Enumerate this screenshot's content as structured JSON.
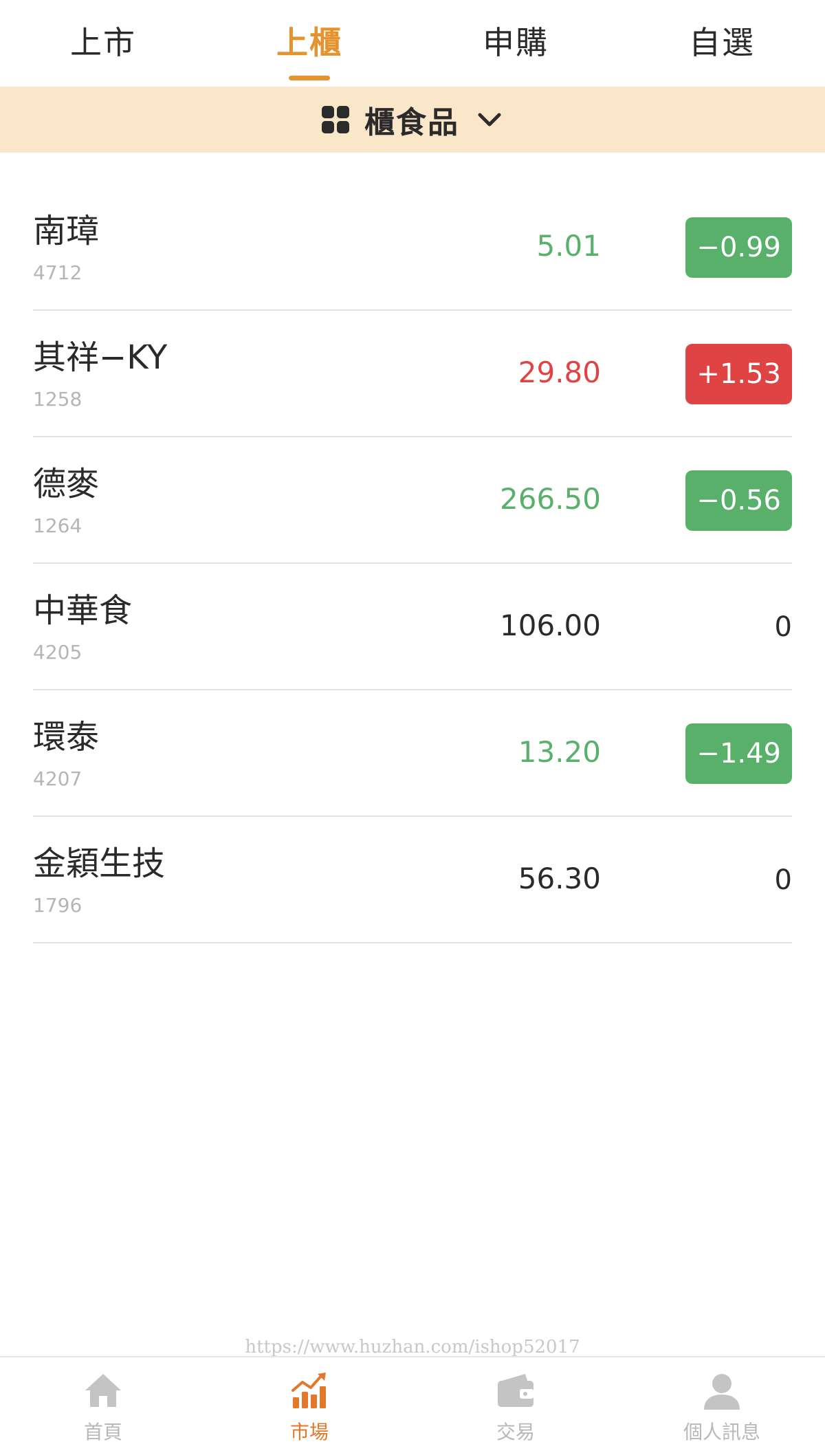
{
  "tabs": [
    {
      "label": "上市",
      "active": false
    },
    {
      "label": "上櫃",
      "active": true
    },
    {
      "label": "申購",
      "active": false
    },
    {
      "label": "自選",
      "active": false
    }
  ],
  "category": {
    "label": "櫃食品",
    "icon": "grid-icon",
    "dropdown_icon": "chevron-down-icon"
  },
  "stocks": [
    {
      "name": "南璋",
      "code": "4712",
      "price": "5.01",
      "change": "−0.99",
      "direction": "down"
    },
    {
      "name": "其祥−KY",
      "code": "1258",
      "price": "29.80",
      "change": "+1.53",
      "direction": "up"
    },
    {
      "name": "德麥",
      "code": "1264",
      "price": "266.50",
      "change": "−0.56",
      "direction": "down"
    },
    {
      "name": "中華食",
      "code": "4205",
      "price": "106.00",
      "change": "0",
      "direction": "flat"
    },
    {
      "name": "環泰",
      "code": "4207",
      "price": "13.20",
      "change": "−1.49",
      "direction": "down"
    },
    {
      "name": "金穎生技",
      "code": "1796",
      "price": "56.30",
      "change": "0",
      "direction": "flat"
    }
  ],
  "watermark": "https://www.huzhan.com/ishop52017",
  "bottom_nav": [
    {
      "label": "首頁",
      "icon": "home-icon",
      "active": false
    },
    {
      "label": "市場",
      "icon": "chart-icon",
      "active": true
    },
    {
      "label": "交易",
      "icon": "wallet-icon",
      "active": false
    },
    {
      "label": "個人訊息",
      "icon": "user-icon",
      "active": false
    }
  ],
  "colors": {
    "accent": "#e5932f",
    "nav_active": "#e3782a",
    "category_bg": "#fae6c8",
    "up": "#e04343",
    "down": "#58b06a",
    "flat": "#2a2a2a",
    "inactive": "#b8b8b8"
  }
}
